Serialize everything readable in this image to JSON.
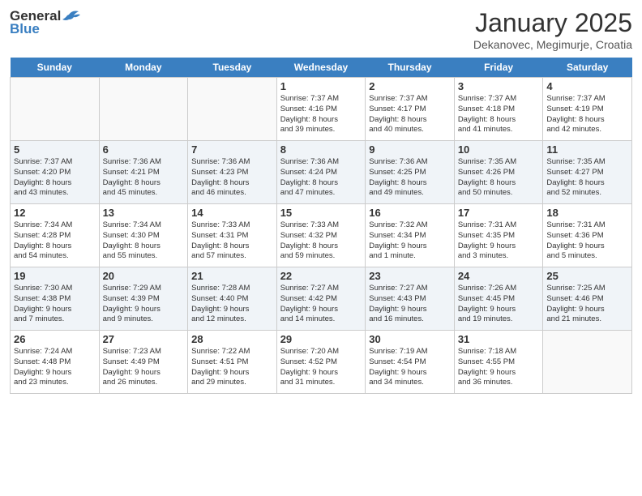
{
  "logo": {
    "general": "General",
    "blue": "Blue"
  },
  "title": "January 2025",
  "subtitle": "Dekanovec, Megimurje, Croatia",
  "days": [
    "Sunday",
    "Monday",
    "Tuesday",
    "Wednesday",
    "Thursday",
    "Friday",
    "Saturday"
  ],
  "weeks": [
    [
      {
        "date": "",
        "info": ""
      },
      {
        "date": "",
        "info": ""
      },
      {
        "date": "",
        "info": ""
      },
      {
        "date": "1",
        "info": "Sunrise: 7:37 AM\nSunset: 4:16 PM\nDaylight: 8 hours\nand 39 minutes."
      },
      {
        "date": "2",
        "info": "Sunrise: 7:37 AM\nSunset: 4:17 PM\nDaylight: 8 hours\nand 40 minutes."
      },
      {
        "date": "3",
        "info": "Sunrise: 7:37 AM\nSunset: 4:18 PM\nDaylight: 8 hours\nand 41 minutes."
      },
      {
        "date": "4",
        "info": "Sunrise: 7:37 AM\nSunset: 4:19 PM\nDaylight: 8 hours\nand 42 minutes."
      }
    ],
    [
      {
        "date": "5",
        "info": "Sunrise: 7:37 AM\nSunset: 4:20 PM\nDaylight: 8 hours\nand 43 minutes."
      },
      {
        "date": "6",
        "info": "Sunrise: 7:36 AM\nSunset: 4:21 PM\nDaylight: 8 hours\nand 45 minutes."
      },
      {
        "date": "7",
        "info": "Sunrise: 7:36 AM\nSunset: 4:23 PM\nDaylight: 8 hours\nand 46 minutes."
      },
      {
        "date": "8",
        "info": "Sunrise: 7:36 AM\nSunset: 4:24 PM\nDaylight: 8 hours\nand 47 minutes."
      },
      {
        "date": "9",
        "info": "Sunrise: 7:36 AM\nSunset: 4:25 PM\nDaylight: 8 hours\nand 49 minutes."
      },
      {
        "date": "10",
        "info": "Sunrise: 7:35 AM\nSunset: 4:26 PM\nDaylight: 8 hours\nand 50 minutes."
      },
      {
        "date": "11",
        "info": "Sunrise: 7:35 AM\nSunset: 4:27 PM\nDaylight: 8 hours\nand 52 minutes."
      }
    ],
    [
      {
        "date": "12",
        "info": "Sunrise: 7:34 AM\nSunset: 4:28 PM\nDaylight: 8 hours\nand 54 minutes."
      },
      {
        "date": "13",
        "info": "Sunrise: 7:34 AM\nSunset: 4:30 PM\nDaylight: 8 hours\nand 55 minutes."
      },
      {
        "date": "14",
        "info": "Sunrise: 7:33 AM\nSunset: 4:31 PM\nDaylight: 8 hours\nand 57 minutes."
      },
      {
        "date": "15",
        "info": "Sunrise: 7:33 AM\nSunset: 4:32 PM\nDaylight: 8 hours\nand 59 minutes."
      },
      {
        "date": "16",
        "info": "Sunrise: 7:32 AM\nSunset: 4:34 PM\nDaylight: 9 hours\nand 1 minute."
      },
      {
        "date": "17",
        "info": "Sunrise: 7:31 AM\nSunset: 4:35 PM\nDaylight: 9 hours\nand 3 minutes."
      },
      {
        "date": "18",
        "info": "Sunrise: 7:31 AM\nSunset: 4:36 PM\nDaylight: 9 hours\nand 5 minutes."
      }
    ],
    [
      {
        "date": "19",
        "info": "Sunrise: 7:30 AM\nSunset: 4:38 PM\nDaylight: 9 hours\nand 7 minutes."
      },
      {
        "date": "20",
        "info": "Sunrise: 7:29 AM\nSunset: 4:39 PM\nDaylight: 9 hours\nand 9 minutes."
      },
      {
        "date": "21",
        "info": "Sunrise: 7:28 AM\nSunset: 4:40 PM\nDaylight: 9 hours\nand 12 minutes."
      },
      {
        "date": "22",
        "info": "Sunrise: 7:27 AM\nSunset: 4:42 PM\nDaylight: 9 hours\nand 14 minutes."
      },
      {
        "date": "23",
        "info": "Sunrise: 7:27 AM\nSunset: 4:43 PM\nDaylight: 9 hours\nand 16 minutes."
      },
      {
        "date": "24",
        "info": "Sunrise: 7:26 AM\nSunset: 4:45 PM\nDaylight: 9 hours\nand 19 minutes."
      },
      {
        "date": "25",
        "info": "Sunrise: 7:25 AM\nSunset: 4:46 PM\nDaylight: 9 hours\nand 21 minutes."
      }
    ],
    [
      {
        "date": "26",
        "info": "Sunrise: 7:24 AM\nSunset: 4:48 PM\nDaylight: 9 hours\nand 23 minutes."
      },
      {
        "date": "27",
        "info": "Sunrise: 7:23 AM\nSunset: 4:49 PM\nDaylight: 9 hours\nand 26 minutes."
      },
      {
        "date": "28",
        "info": "Sunrise: 7:22 AM\nSunset: 4:51 PM\nDaylight: 9 hours\nand 29 minutes."
      },
      {
        "date": "29",
        "info": "Sunrise: 7:20 AM\nSunset: 4:52 PM\nDaylight: 9 hours\nand 31 minutes."
      },
      {
        "date": "30",
        "info": "Sunrise: 7:19 AM\nSunset: 4:54 PM\nDaylight: 9 hours\nand 34 minutes."
      },
      {
        "date": "31",
        "info": "Sunrise: 7:18 AM\nSunset: 4:55 PM\nDaylight: 9 hours\nand 36 minutes."
      },
      {
        "date": "",
        "info": ""
      }
    ]
  ]
}
